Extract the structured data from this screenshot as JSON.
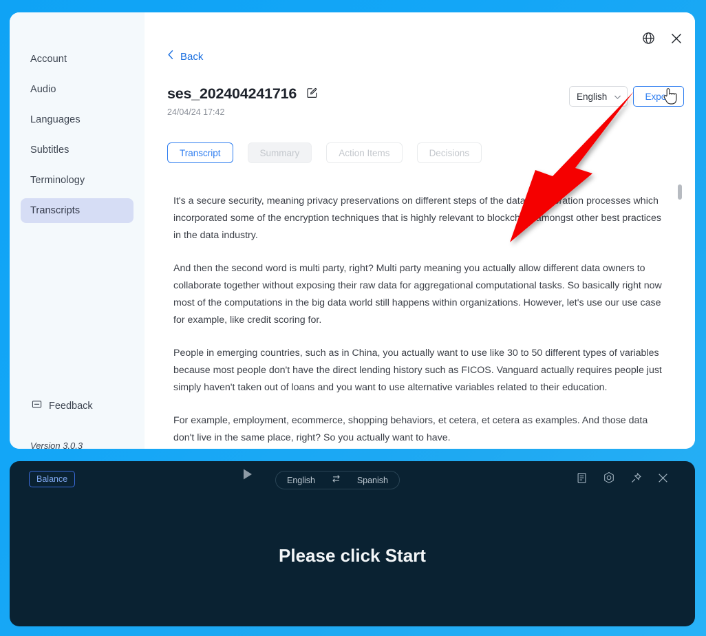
{
  "theme": {
    "bg_blue": "#13a6f7",
    "accent_blue": "#2d7df0",
    "dark_panel": "#0a2232",
    "sidebar_bg": "#f4f9fc",
    "active_nav_bg": "#d6ddf5",
    "annotation_red": "#f50000"
  },
  "sidebar": {
    "items": [
      {
        "label": "Account",
        "active": false
      },
      {
        "label": "Audio",
        "active": false
      },
      {
        "label": "Languages",
        "active": false
      },
      {
        "label": "Subtitles",
        "active": false
      },
      {
        "label": "Terminology",
        "active": false
      },
      {
        "label": "Transcripts",
        "active": true
      }
    ],
    "feedback_label": "Feedback",
    "feedback_icon": "message-bubble-icon",
    "version_label": "Version 3.0.3"
  },
  "header": {
    "back_label": "Back",
    "back_icon": "chevron-left-icon",
    "globe_icon": "globe-icon",
    "close_icon": "close-icon",
    "title": "ses_202404241716",
    "edit_icon": "edit-pencil-icon",
    "date": "24/04/24 17:42",
    "language_select": {
      "value": "English",
      "chevron_icon": "chevron-down-icon",
      "options": [
        "English"
      ]
    },
    "export_label": "Export"
  },
  "tabs": [
    {
      "label": "Transcript",
      "state": "active"
    },
    {
      "label": "Summary",
      "state": "filled"
    },
    {
      "label": "Action Items",
      "state": "ghost"
    },
    {
      "label": "Decisions",
      "state": "ghost"
    }
  ],
  "transcript": {
    "paragraphs": [
      "It's a secure security, meaning privacy preservations on different steps of the data collaboration processes which incorporated some of the encryption techniques that is highly relevant to blockchain amongst other best practices in the data industry.",
      "And then the second word is multi party, right? Multi party meaning you actually allow different data owners to collaborate together without exposing their raw data for aggregational computational tasks. So basically right now most of the computations in the big data world still happens within organizations. However, let's use our use case for example, like credit scoring for.",
      "People in emerging countries, such as in China, you actually want to use like 30 to 50 different types of variables because most people don't have the direct lending history such as FICOS. Vanguard actually requires people just simply haven't taken out of loans and you want to use alternative variables related to their education.",
      "For example, employment, ecommerce, shopping behaviors, et cetera, et cetera as examples. And those data don't live in the same place, right? So you actually want to have."
    ]
  },
  "bottom_panel": {
    "balance_label": "Balance",
    "play_icon": "play-icon",
    "source_language": "English",
    "swap_icon": "swap-arrows-icon",
    "target_language": "Spanish",
    "icons": [
      {
        "name": "notes-icon"
      },
      {
        "name": "settings-gear-icon"
      },
      {
        "name": "pin-icon"
      },
      {
        "name": "close-icon"
      }
    ],
    "status_message": "Please click Start"
  },
  "annotation": {
    "arrow_target": "export-button",
    "cursor_type": "pointing-hand"
  }
}
